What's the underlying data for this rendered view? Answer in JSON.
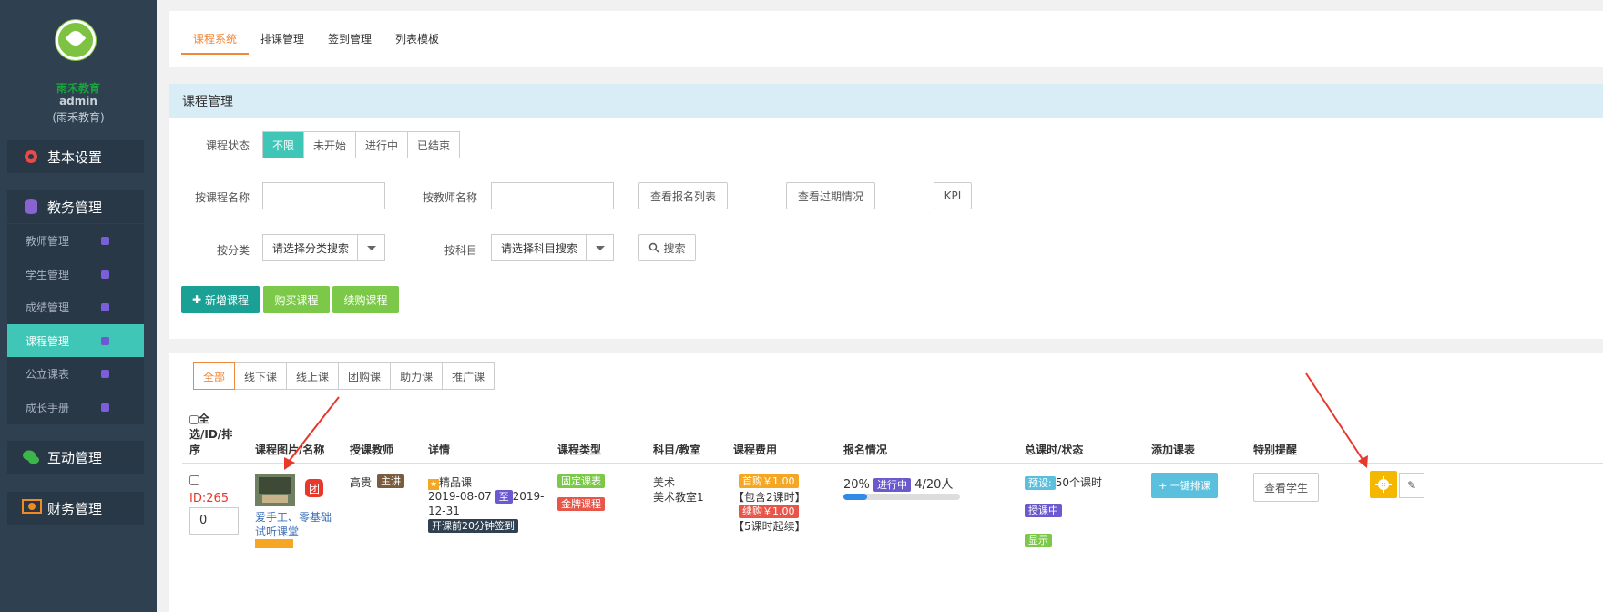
{
  "sidebar": {
    "org_name": "雨禾教育",
    "username": "admin",
    "user_org": "(雨禾教育)",
    "sections": [
      {
        "label": "基本设置",
        "icon": "gear-icon"
      },
      {
        "label": "教务管理",
        "icon": "database-icon"
      },
      {
        "label": "互动管理",
        "icon": "wechat-icon"
      },
      {
        "label": "财务管理",
        "icon": "money-icon"
      }
    ],
    "items": [
      "教师管理",
      "学生管理",
      "成绩管理",
      "课程管理",
      "公立课表",
      "成长手册"
    ],
    "active_item": "课程管理"
  },
  "top_tabs": [
    "课程系统",
    "排课管理",
    "签到管理",
    "列表模板"
  ],
  "filter": {
    "title": "课程管理",
    "status_label": "课程状态",
    "status_options": [
      "不限",
      "未开始",
      "进行中",
      "已结束"
    ],
    "name_label": "按课程名称",
    "teacher_label": "按教师名称",
    "btn_enroll_list": "查看报名列表",
    "btn_expired": "查看过期情况",
    "btn_kpi": "KPI",
    "category_label": "按分类",
    "category_placeholder": "请选择分类搜索",
    "subject_label": "按科目",
    "subject_placeholder": "请选择科目搜索",
    "search_label": "搜索",
    "btn_add": "新增课程",
    "btn_buy": "购买课程",
    "btn_renew": "续购课程"
  },
  "list": {
    "type_tabs": [
      "全部",
      "线下课",
      "线上课",
      "团购课",
      "助力课",
      "推广课"
    ],
    "headers": {
      "select": "全",
      "select2": "选/ID/排",
      "select3": "序",
      "image": "课程图片/名称",
      "teacher": "授课教师",
      "detail": "详情",
      "type": "课程类型",
      "subject": "科目/教室",
      "fee": "课程费用",
      "enroll": "报名情况",
      "hours": "总课时/状态",
      "schedule": "添加课表",
      "remind": "特别提醒"
    },
    "row": {
      "id": "ID:265",
      "sort": "0",
      "group_badge": "团",
      "name_line1": "爱手工、零基础",
      "name_line2": "试听课堂",
      "teacher": "高贵",
      "teacher_tag": "主讲",
      "quality": "精品课",
      "date_start": "2019-08-07",
      "date_to": "至",
      "date_end1": "2019-",
      "date_end2": "12-31",
      "signin": "开课前20分钟签到",
      "type_tag1": "固定课表",
      "type_tag2": "金牌课程",
      "subject": "美术",
      "room": "美术教室1",
      "fee_first": "首购￥1.00",
      "fee_include": "【包含2课时】",
      "fee_renew": "续购￥1.00",
      "fee_renew_note": "【5课时起续】",
      "enroll_pct": "20%",
      "enroll_status": "进行中",
      "enroll_count": "4/20人",
      "enroll_progress": 0.2,
      "hours_tag": "预设:",
      "hours_text": "50个课时",
      "hours_status": "授课中",
      "show_tag": "显示",
      "btn_schedule": "+ 一键排课",
      "btn_students": "查看学生"
    }
  }
}
